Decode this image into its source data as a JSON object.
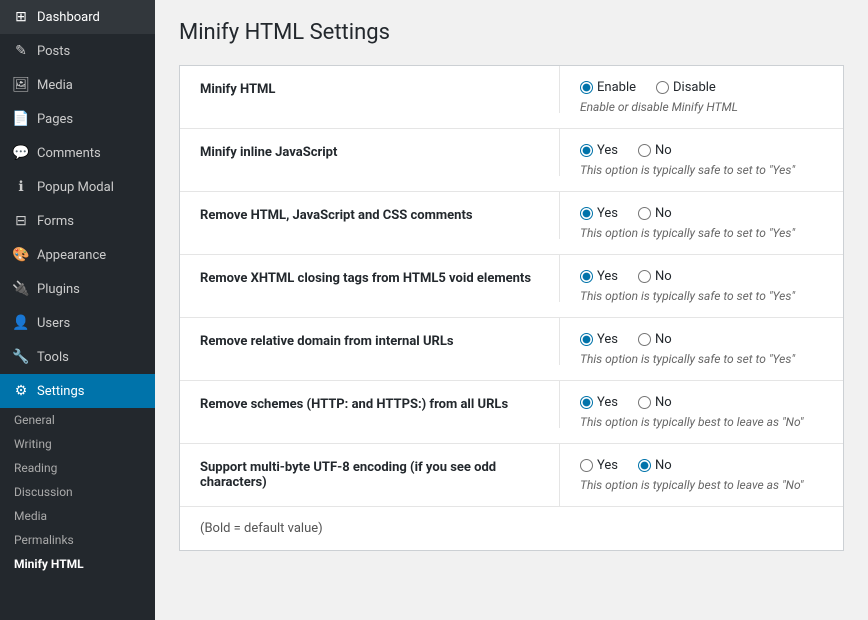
{
  "sidebar": {
    "items": [
      {
        "id": "dashboard",
        "label": "Dashboard",
        "icon": "⊞"
      },
      {
        "id": "posts",
        "label": "Posts",
        "icon": "✎"
      },
      {
        "id": "media",
        "label": "Media",
        "icon": "🖼"
      },
      {
        "id": "pages",
        "label": "Pages",
        "icon": "📄"
      },
      {
        "id": "comments",
        "label": "Comments",
        "icon": "💬"
      },
      {
        "id": "popup-modal",
        "label": "Popup Modal",
        "icon": "ℹ"
      },
      {
        "id": "forms",
        "label": "Forms",
        "icon": "⊟"
      },
      {
        "id": "appearance",
        "label": "Appearance",
        "icon": "🎨"
      },
      {
        "id": "plugins",
        "label": "Plugins",
        "icon": "🔌"
      },
      {
        "id": "users",
        "label": "Users",
        "icon": "👤"
      },
      {
        "id": "tools",
        "label": "Tools",
        "icon": "🔧"
      },
      {
        "id": "settings",
        "label": "Settings",
        "icon": "⚙",
        "active": true
      }
    ],
    "sub_items": [
      {
        "id": "general",
        "label": "General"
      },
      {
        "id": "writing",
        "label": "Writing"
      },
      {
        "id": "reading",
        "label": "Reading"
      },
      {
        "id": "discussion",
        "label": "Discussion"
      },
      {
        "id": "media",
        "label": "Media"
      },
      {
        "id": "permalinks",
        "label": "Permalinks"
      },
      {
        "id": "minify-html",
        "label": "Minify HTML",
        "active": true
      }
    ]
  },
  "page": {
    "title": "Minify HTML Settings"
  },
  "settings": [
    {
      "id": "minify-html",
      "label": "Minify HTML",
      "options": [
        {
          "value": "enable",
          "label": "Enable",
          "checked": true
        },
        {
          "value": "disable",
          "label": "Disable",
          "checked": false
        }
      ],
      "hint": "Enable or disable Minify HTML"
    },
    {
      "id": "minify-inline-js",
      "label": "Minify inline JavaScript",
      "options": [
        {
          "value": "yes",
          "label": "Yes",
          "checked": true
        },
        {
          "value": "no",
          "label": "No",
          "checked": false
        }
      ],
      "hint": "This option is typically safe to set to \"Yes\""
    },
    {
      "id": "remove-html-comments",
      "label": "Remove HTML, JavaScript and CSS comments",
      "options": [
        {
          "value": "yes",
          "label": "Yes",
          "checked": true
        },
        {
          "value": "no",
          "label": "No",
          "checked": false
        }
      ],
      "hint": "This option is typically safe to set to \"Yes\""
    },
    {
      "id": "remove-xhtml-closing",
      "label": "Remove XHTML closing tags from HTML5 void elements",
      "options": [
        {
          "value": "yes",
          "label": "Yes",
          "checked": true
        },
        {
          "value": "no",
          "label": "No",
          "checked": false
        }
      ],
      "hint": "This option is typically safe to set to \"Yes\""
    },
    {
      "id": "remove-relative-domain",
      "label": "Remove relative domain from internal URLs",
      "options": [
        {
          "value": "yes",
          "label": "Yes",
          "checked": true
        },
        {
          "value": "no",
          "label": "No",
          "checked": false
        }
      ],
      "hint": "This option is typically safe to set to \"Yes\""
    },
    {
      "id": "remove-schemes",
      "label": "Remove schemes (HTTP: and HTTPS:) from all URLs",
      "options": [
        {
          "value": "yes",
          "label": "Yes",
          "checked": true
        },
        {
          "value": "no",
          "label": "No",
          "checked": false
        }
      ],
      "hint": "This option is typically best to leave as \"No\""
    },
    {
      "id": "support-multibyte",
      "label": "Support multi-byte UTF-8 encoding (if you see odd characters)",
      "options": [
        {
          "value": "yes",
          "label": "Yes",
          "checked": false
        },
        {
          "value": "no",
          "label": "No",
          "checked": true
        }
      ],
      "hint": "This option is typically best to leave as \"No\""
    }
  ],
  "footer_note": "(Bold = default value)"
}
